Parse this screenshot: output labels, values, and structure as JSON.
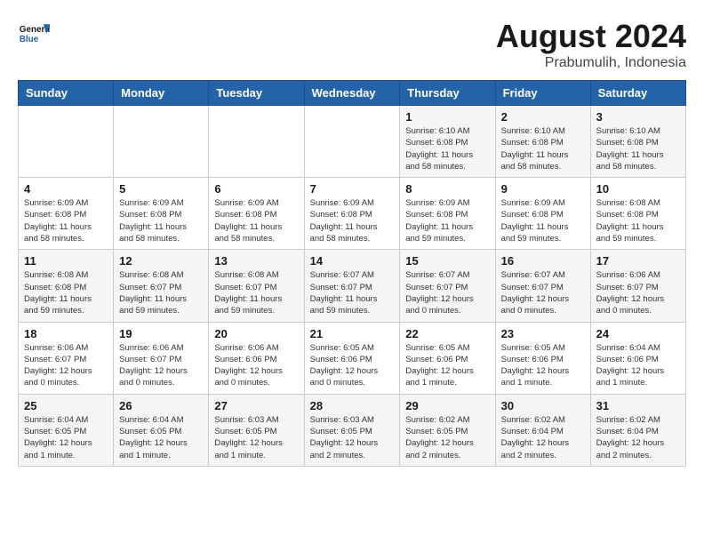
{
  "header": {
    "logo_general": "General",
    "logo_blue": "Blue",
    "month": "August 2024",
    "location": "Prabumulih, Indonesia"
  },
  "weekdays": [
    "Sunday",
    "Monday",
    "Tuesday",
    "Wednesday",
    "Thursday",
    "Friday",
    "Saturday"
  ],
  "weeks": [
    [
      {
        "day": "",
        "info": ""
      },
      {
        "day": "",
        "info": ""
      },
      {
        "day": "",
        "info": ""
      },
      {
        "day": "",
        "info": ""
      },
      {
        "day": "1",
        "info": "Sunrise: 6:10 AM\nSunset: 6:08 PM\nDaylight: 11 hours\nand 58 minutes."
      },
      {
        "day": "2",
        "info": "Sunrise: 6:10 AM\nSunset: 6:08 PM\nDaylight: 11 hours\nand 58 minutes."
      },
      {
        "day": "3",
        "info": "Sunrise: 6:10 AM\nSunset: 6:08 PM\nDaylight: 11 hours\nand 58 minutes."
      }
    ],
    [
      {
        "day": "4",
        "info": "Sunrise: 6:09 AM\nSunset: 6:08 PM\nDaylight: 11 hours\nand 58 minutes."
      },
      {
        "day": "5",
        "info": "Sunrise: 6:09 AM\nSunset: 6:08 PM\nDaylight: 11 hours\nand 58 minutes."
      },
      {
        "day": "6",
        "info": "Sunrise: 6:09 AM\nSunset: 6:08 PM\nDaylight: 11 hours\nand 58 minutes."
      },
      {
        "day": "7",
        "info": "Sunrise: 6:09 AM\nSunset: 6:08 PM\nDaylight: 11 hours\nand 58 minutes."
      },
      {
        "day": "8",
        "info": "Sunrise: 6:09 AM\nSunset: 6:08 PM\nDaylight: 11 hours\nand 59 minutes."
      },
      {
        "day": "9",
        "info": "Sunrise: 6:09 AM\nSunset: 6:08 PM\nDaylight: 11 hours\nand 59 minutes."
      },
      {
        "day": "10",
        "info": "Sunrise: 6:08 AM\nSunset: 6:08 PM\nDaylight: 11 hours\nand 59 minutes."
      }
    ],
    [
      {
        "day": "11",
        "info": "Sunrise: 6:08 AM\nSunset: 6:08 PM\nDaylight: 11 hours\nand 59 minutes."
      },
      {
        "day": "12",
        "info": "Sunrise: 6:08 AM\nSunset: 6:07 PM\nDaylight: 11 hours\nand 59 minutes."
      },
      {
        "day": "13",
        "info": "Sunrise: 6:08 AM\nSunset: 6:07 PM\nDaylight: 11 hours\nand 59 minutes."
      },
      {
        "day": "14",
        "info": "Sunrise: 6:07 AM\nSunset: 6:07 PM\nDaylight: 11 hours\nand 59 minutes."
      },
      {
        "day": "15",
        "info": "Sunrise: 6:07 AM\nSunset: 6:07 PM\nDaylight: 12 hours\nand 0 minutes."
      },
      {
        "day": "16",
        "info": "Sunrise: 6:07 AM\nSunset: 6:07 PM\nDaylight: 12 hours\nand 0 minutes."
      },
      {
        "day": "17",
        "info": "Sunrise: 6:06 AM\nSunset: 6:07 PM\nDaylight: 12 hours\nand 0 minutes."
      }
    ],
    [
      {
        "day": "18",
        "info": "Sunrise: 6:06 AM\nSunset: 6:07 PM\nDaylight: 12 hours\nand 0 minutes."
      },
      {
        "day": "19",
        "info": "Sunrise: 6:06 AM\nSunset: 6:07 PM\nDaylight: 12 hours\nand 0 minutes."
      },
      {
        "day": "20",
        "info": "Sunrise: 6:06 AM\nSunset: 6:06 PM\nDaylight: 12 hours\nand 0 minutes."
      },
      {
        "day": "21",
        "info": "Sunrise: 6:05 AM\nSunset: 6:06 PM\nDaylight: 12 hours\nand 0 minutes."
      },
      {
        "day": "22",
        "info": "Sunrise: 6:05 AM\nSunset: 6:06 PM\nDaylight: 12 hours\nand 1 minute."
      },
      {
        "day": "23",
        "info": "Sunrise: 6:05 AM\nSunset: 6:06 PM\nDaylight: 12 hours\nand 1 minute."
      },
      {
        "day": "24",
        "info": "Sunrise: 6:04 AM\nSunset: 6:06 PM\nDaylight: 12 hours\nand 1 minute."
      }
    ],
    [
      {
        "day": "25",
        "info": "Sunrise: 6:04 AM\nSunset: 6:05 PM\nDaylight: 12 hours\nand 1 minute."
      },
      {
        "day": "26",
        "info": "Sunrise: 6:04 AM\nSunset: 6:05 PM\nDaylight: 12 hours\nand 1 minute."
      },
      {
        "day": "27",
        "info": "Sunrise: 6:03 AM\nSunset: 6:05 PM\nDaylight: 12 hours\nand 1 minute."
      },
      {
        "day": "28",
        "info": "Sunrise: 6:03 AM\nSunset: 6:05 PM\nDaylight: 12 hours\nand 2 minutes."
      },
      {
        "day": "29",
        "info": "Sunrise: 6:02 AM\nSunset: 6:05 PM\nDaylight: 12 hours\nand 2 minutes."
      },
      {
        "day": "30",
        "info": "Sunrise: 6:02 AM\nSunset: 6:04 PM\nDaylight: 12 hours\nand 2 minutes."
      },
      {
        "day": "31",
        "info": "Sunrise: 6:02 AM\nSunset: 6:04 PM\nDaylight: 12 hours\nand 2 minutes."
      }
    ]
  ]
}
